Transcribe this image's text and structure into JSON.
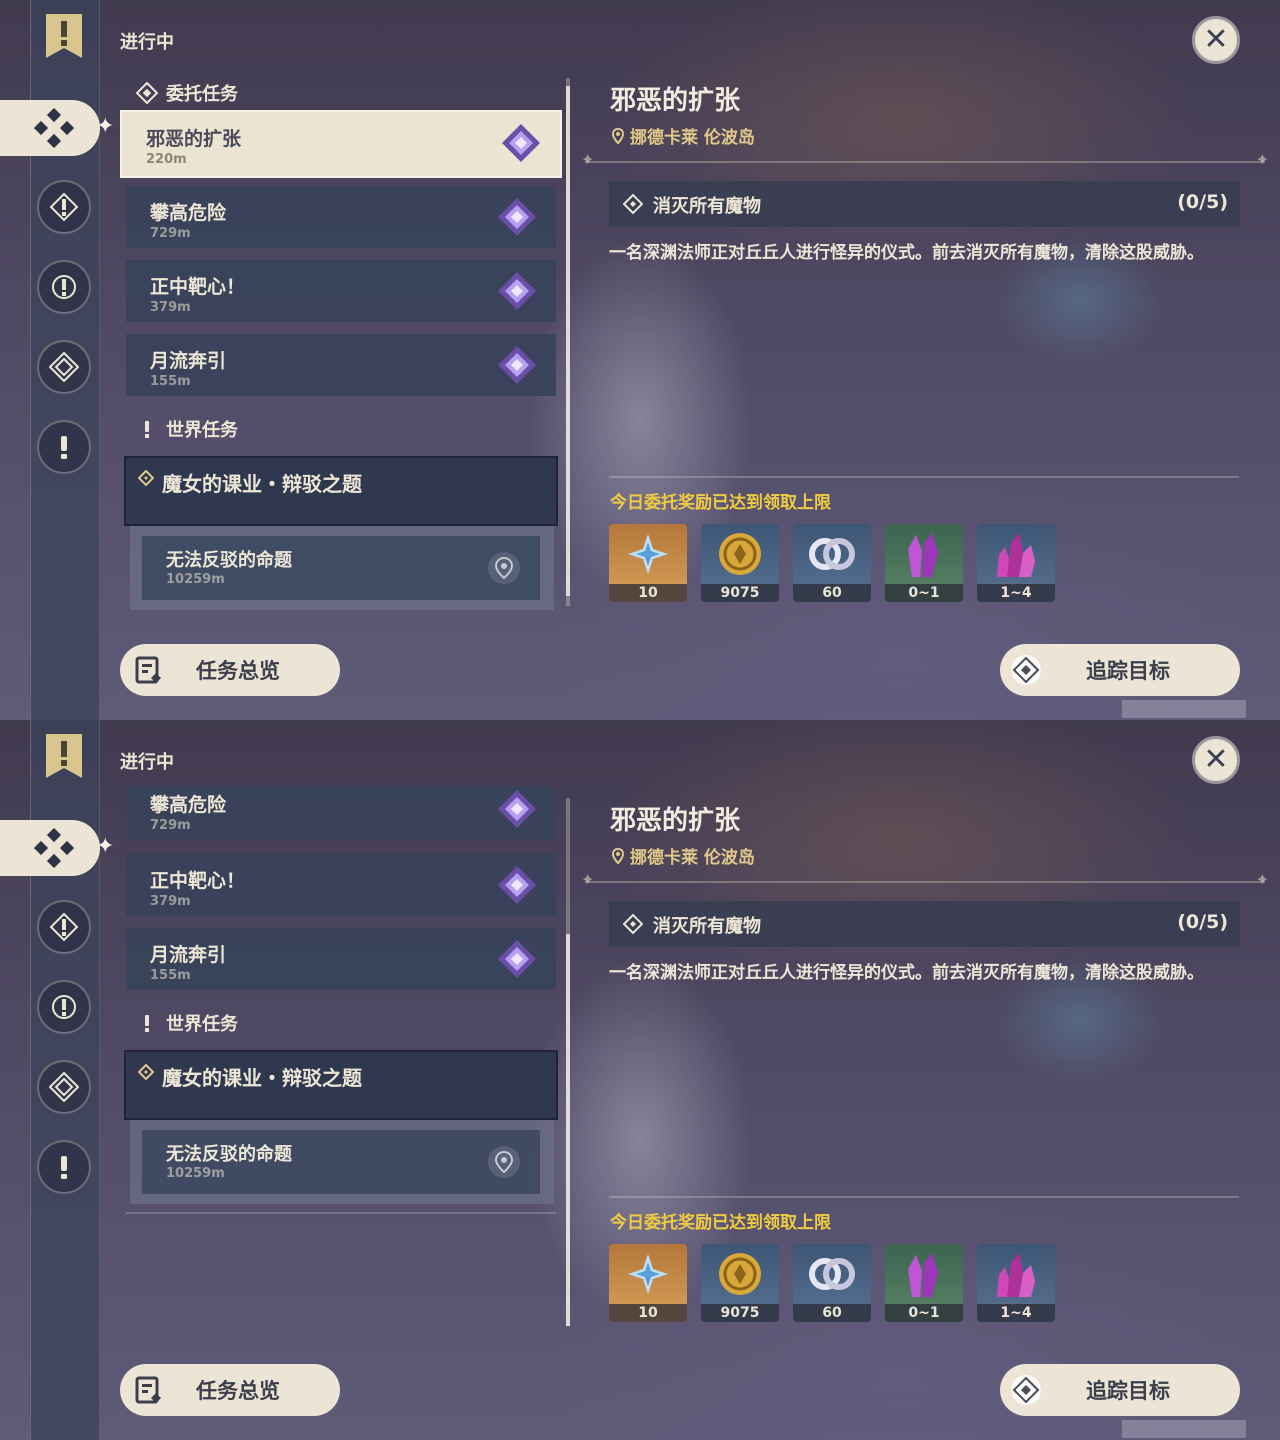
{
  "header": {
    "title": "进行中"
  },
  "sections": {
    "commissions": "委托任务",
    "world": "世界任务"
  },
  "commissions": [
    {
      "name": "邪恶的扩张",
      "distance": "220m"
    },
    {
      "name": "攀高危险",
      "distance": "729m"
    },
    {
      "name": "正中靶心！",
      "distance": "379m"
    },
    {
      "name": "月流奔引",
      "distance": "155m"
    }
  ],
  "world_quest": {
    "name": "魔女的课业・辩驳之题",
    "sub": {
      "name": "无法反驳的命题",
      "distance": "10259m"
    }
  },
  "detail": {
    "title": "邪恶的扩张",
    "location": "挪德卡莱 伦波岛",
    "objective": "消灭所有魔物",
    "progress": "(0/5)",
    "description": "一名深渊法师正对丘丘人进行怪异的仪式。前去消灭所有魔物，清除这股威胁。",
    "reward_note": "今日委托奖励已达到领取上限",
    "rewards": [
      {
        "icon": "primogem-icon",
        "qty": "10"
      },
      {
        "icon": "mora-icon",
        "qty": "9075"
      },
      {
        "icon": "companionship-exp-icon",
        "qty": "60"
      },
      {
        "icon": "crystal-chunk-icon",
        "qty": "0~1"
      },
      {
        "icon": "crystal-cluster-icon",
        "qty": "1~4"
      }
    ]
  },
  "buttons": {
    "overview": "任务总览",
    "track": "追踪目标"
  },
  "colors": {
    "accent_gold": "#f0cc40",
    "location_gold": "#e0c98a",
    "cream": "#ece5d6",
    "panel": "#37425a"
  }
}
